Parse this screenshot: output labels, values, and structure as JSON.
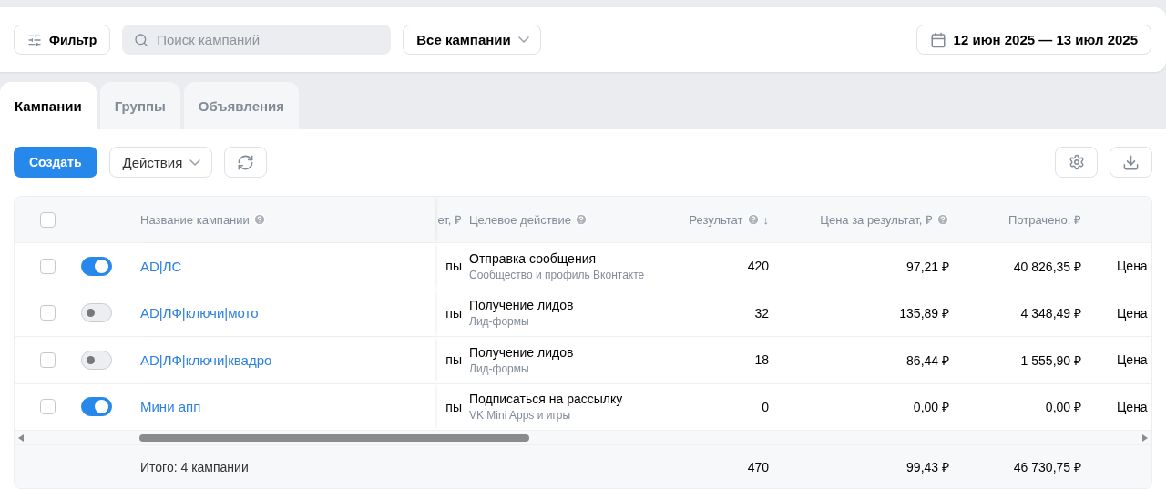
{
  "toolbar": {
    "filter_button": "Фильтр",
    "search": {
      "placeholder": "Поиск кампаний"
    },
    "campaign_select": "Все кампании",
    "date_range": "12 июн 2025 — 13 июл 2025"
  },
  "tabs": [
    {
      "label": "Кампании",
      "selected": true
    },
    {
      "label": "Группы",
      "selected": false
    },
    {
      "label": "Объявления",
      "selected": false
    }
  ],
  "actions": {
    "create_button": "Создать",
    "actions_select": "Действия"
  },
  "table": {
    "header_checked": false,
    "columns": [
      {
        "label": "Название кампании",
        "help": true
      },
      {
        "label": "ет, ₽",
        "help": false
      },
      {
        "label": "Целевое действие",
        "help": true
      },
      {
        "label": "Результат",
        "help": true,
        "sort": "↓"
      },
      {
        "label": "Цена за результат, ₽",
        "help": true
      },
      {
        "label": "Потрачено, ₽",
        "help": false
      }
    ],
    "rows": [
      {
        "checked": false,
        "on": true,
        "name": "AD|ЛС",
        "column_2": "пы",
        "target_action": "Отправка сообщения",
        "target_detail": "Сообщество и профиль Вконтакте",
        "result": "420",
        "price": "97,21 ₽",
        "spent": "40 826,35 ₽",
        "column_7": "Цена"
      },
      {
        "checked": false,
        "on": false,
        "name": "AD|ЛФ|ключи|мото",
        "column_2": "пы",
        "target_action": "Получение лидов",
        "target_detail": "Лид-формы",
        "result": "32",
        "price": "135,89 ₽",
        "spent": "4 348,49 ₽",
        "column_7": "Цена"
      },
      {
        "checked": false,
        "on": false,
        "name": "AD|ЛФ|ключи|квадро",
        "column_2": "пы",
        "target_action": "Получение лидов",
        "target_detail": "Лид-формы",
        "result": "18",
        "price": "86,44 ₽",
        "spent": "1 555,90 ₽",
        "column_7": "Цена"
      },
      {
        "checked": false,
        "on": true,
        "name": "Мини апп",
        "column_2": "пы",
        "target_action": "Подписаться на рассылку",
        "target_detail": "VK Mini Apps и игры",
        "result": "0",
        "price": "0,00 ₽",
        "spent": "0,00 ₽",
        "column_7": "Цена"
      }
    ],
    "footer": {
      "total_label": "Итого: 4 кампании",
      "result": "470",
      "price": "99,43 ₽",
      "spent": "46 730,75 ₽"
    }
  }
}
